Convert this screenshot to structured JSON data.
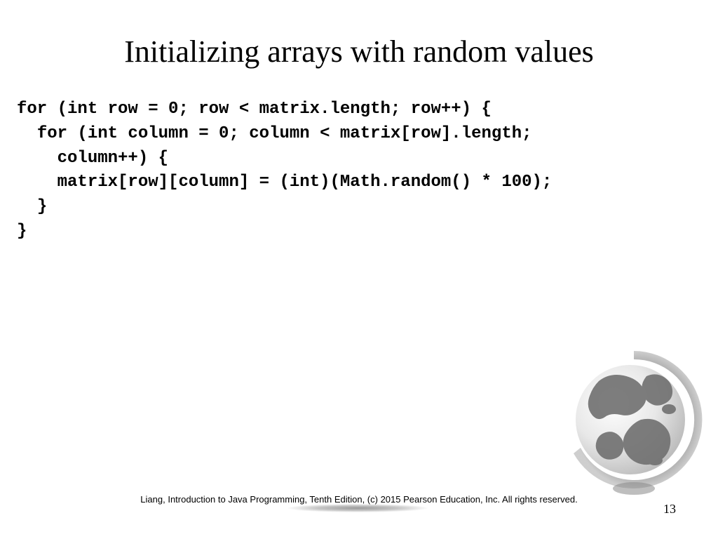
{
  "title": "Initializing arrays with random values",
  "code": "for (int row = 0; row < matrix.length; row++) {\n  for (int column = 0; column < matrix[row].length;\n    column++) {\n    matrix[row][column] = (int)(Math.random() * 100);\n  }\n}",
  "footer": "Liang, Introduction to Java Programming, Tenth Edition, (c) 2015 Pearson Education, Inc. All rights reserved.",
  "page_number": "13"
}
